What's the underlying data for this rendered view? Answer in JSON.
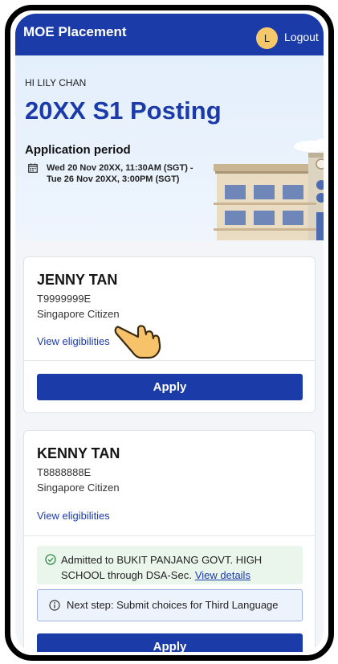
{
  "app": {
    "title": "MOE Placement",
    "avatar_initial": "L",
    "logout_label": "Logout"
  },
  "hero": {
    "greeting": "HI LILY CHAN",
    "title": "20XX S1 Posting",
    "application_period_label": "Application period",
    "period_line1": "Wed 20 Nov 20XX, 11:30AM (SGT) -",
    "period_line2": "Tue 26 Nov 20XX, 3:00PM (SGT)"
  },
  "children": [
    {
      "name": "JENNY TAN",
      "id": "T9999999E",
      "citizenship": "Singapore Citizen",
      "view_eligibilities": "View eligibilities",
      "apply_label": "Apply"
    },
    {
      "name": "KENNY TAN",
      "id": "T8888888E",
      "citizenship": "Singapore Citizen",
      "view_eligibilities": "View eligibilities",
      "admission_text": "Admitted to BUKIT PANJANG GOVT. HIGH SCHOOL through DSA-Sec.",
      "view_details": "View details",
      "next_step": "Next step: Submit choices for Third Language",
      "apply_label": "Apply"
    }
  ],
  "colors": {
    "primary": "#1b3ba9",
    "hero_bg": "#e4effc",
    "success_bg": "#eaf6ec",
    "info_bg": "#edf3fc",
    "avatar": "#f5c86a"
  }
}
